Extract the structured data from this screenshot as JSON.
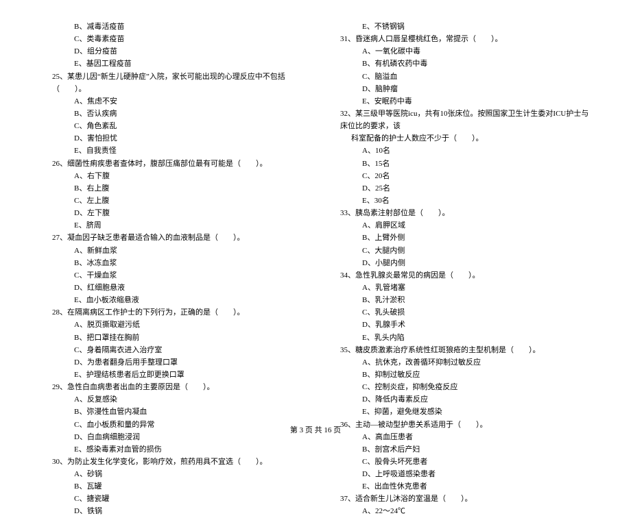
{
  "leftColumn": {
    "q24_options_tail": [
      "B、减毒活疫苗",
      "C、类毒素疫苗",
      "D、组分疫苗",
      "E、基因工程疫苗"
    ],
    "questions": [
      {
        "num": "25、",
        "text": "某患儿因“新生儿硬肿症”入院，家长可能出现的心理反应中不包括（　　）。",
        "options": [
          "A、焦虑不安",
          "B、否认疾病",
          "C、角色紊乱",
          "D、害怕担忧",
          "E、自我责怪"
        ]
      },
      {
        "num": "26、",
        "text": "细菌性痢疾患者查体时，腹部压痛部位最有可能是（　　）。",
        "options": [
          "A、右下腹",
          "B、右上腹",
          "C、左上腹",
          "D、左下腹",
          "E、脐周"
        ]
      },
      {
        "num": "27、",
        "text": "凝血因子缺乏患者最适合输入的血液制品是（　　）。",
        "options": [
          "A、新鲜血浆",
          "B、冰冻血浆",
          "C、干燥血浆",
          "D、红细胞悬液",
          "E、血小板浓缩悬液"
        ]
      },
      {
        "num": "28、",
        "text": "在隔离病区工作护士的下列行为，正确的是（　　）。",
        "options": [
          "A、脱页撕取避污纸",
          "B、把口罩挂在胸前",
          "C、身着隔离衣进入治疗室",
          "D、为患者翻身后用手整理口罩",
          "E、护理结核患者后立即更换口罩"
        ]
      },
      {
        "num": "29、",
        "text": "急性白血病患者出血的主要原因是（　　）。",
        "options": [
          "A、反复感染",
          "B、弥漫性血管内凝血",
          "C、血小板质和量的异常",
          "D、白血病细胞浸润",
          "E、感染毒素对血管的损伤"
        ]
      },
      {
        "num": "30、",
        "text": "为防止发生化学变化，影响疗效，煎药用具不宜选（　　）。",
        "options": [
          "A、砂锅",
          "B、瓦罐",
          "C、搪瓷罐",
          "D、铁锅"
        ]
      }
    ]
  },
  "rightColumn": {
    "q30_options_tail": [
      "E、不锈钢锅"
    ],
    "questions": [
      {
        "num": "31、",
        "text": "昏迷病人口唇呈樱桃红色，常提示（　　）。",
        "options": [
          "A、一氧化碳中毒",
          "B、有机磷农药中毒",
          "C、脑溢血",
          "D、脑肿瘤",
          "E、安眠药中毒"
        ]
      },
      {
        "num": "32、",
        "text": "某三级甲等医院icu，共有10张床位。按照国家卫生计生委对ICU护士与床位比的要求，该",
        "cont": "科室配备的护士人数应不少于（　　）。",
        "options": [
          "A、10名",
          "B、15名",
          "C、20名",
          "D、25名",
          "E、30名"
        ]
      },
      {
        "num": "33、",
        "text": "胰岛素注射部位是（　　）。",
        "options": [
          "A、肩胛区域",
          "B、上臂外侧",
          "C、大腿内侧",
          "D、小腿内侧"
        ]
      },
      {
        "num": "34、",
        "text": "急性乳腺炎最常见的病因是（　　）。",
        "options": [
          "A、乳管堵塞",
          "B、乳汁淤积",
          "C、乳头破损",
          "D、乳腺手术",
          "E、乳头内陷"
        ]
      },
      {
        "num": "35、",
        "text": "糖皮质激素治疗系统性红斑狼疮的主型机制是（　　）。",
        "options": [
          "A、抗休克，改善循环抑制过敏反应",
          "B、抑制过敏反应",
          "C、控制炎症，抑制免疫反应",
          "D、降低内毒素反应",
          "E、抑菌，避免继发感染"
        ]
      },
      {
        "num": "36、",
        "text": "主动—被动型护患关系适用于（　　）。",
        "options": [
          "A、高血压患者",
          "B、剖宫术后产妇",
          "C、股骨头坏死患者",
          "D、上呼吸道感染患者",
          "E、出血性休克患者"
        ]
      },
      {
        "num": "37、",
        "text": "适合新生儿沐浴的室温是（　　）。",
        "options": [
          "A、22～24℃"
        ]
      }
    ]
  },
  "footer": "第 3 页 共 16 页"
}
